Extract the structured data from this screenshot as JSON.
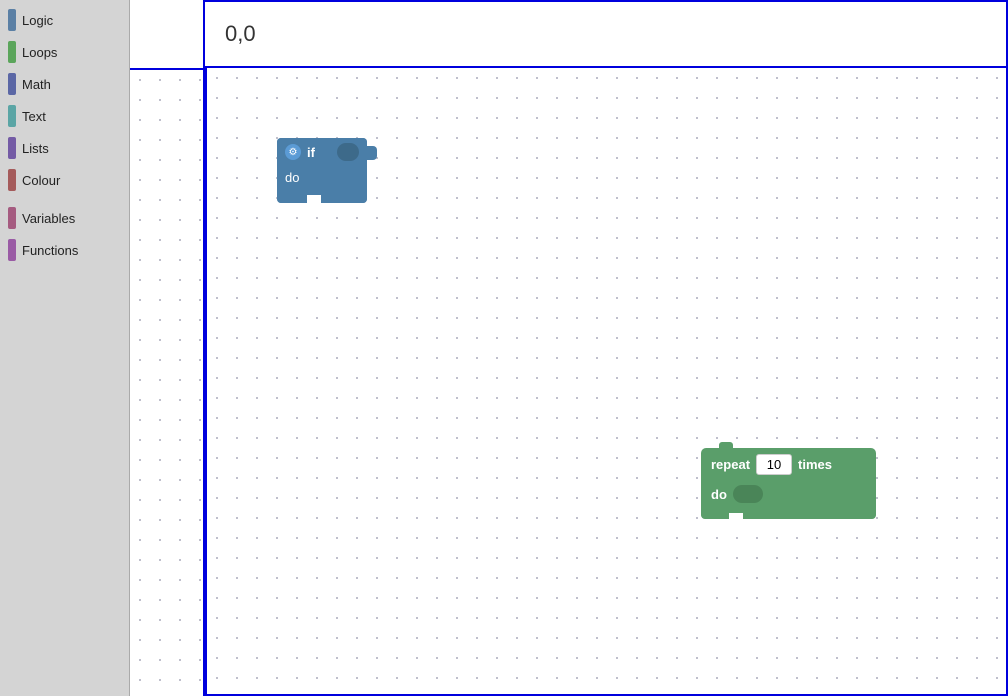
{
  "sidebar": {
    "items": [
      {
        "label": "Logic",
        "color": "#5b80a5",
        "id": "logic"
      },
      {
        "label": "Loops",
        "color": "#5ba55b",
        "id": "loops"
      },
      {
        "label": "Math",
        "color": "#5b67a5",
        "id": "math"
      },
      {
        "label": "Text",
        "color": "#5ba5a5",
        "id": "text"
      },
      {
        "label": "Lists",
        "color": "#745ba5",
        "id": "lists"
      },
      {
        "label": "Colour",
        "color": "#a55b5b",
        "id": "colour"
      },
      {
        "label": "Variables",
        "color": "#a55b80",
        "id": "variables"
      },
      {
        "label": "Functions",
        "color": "#9a5ba5",
        "id": "functions"
      }
    ]
  },
  "coord": {
    "value": "0,0"
  },
  "blocks": {
    "if_block": {
      "if_label": "if",
      "do_label": "do"
    },
    "repeat_block": {
      "repeat_label": "repeat",
      "times_value": "10",
      "times_label": "times",
      "do_label": "do"
    }
  },
  "colors": {
    "border": "#0000dd",
    "logic": "#5b80a5",
    "loops": "#5ba55b",
    "math": "#5b67a5",
    "text": "#5ba5a5",
    "lists": "#745ba5",
    "colour": "#a55b5b",
    "variables": "#a55b80",
    "functions": "#9a5ba5",
    "if_block_bg": "#4a7ea8",
    "repeat_block_bg": "#5a9e6a"
  }
}
